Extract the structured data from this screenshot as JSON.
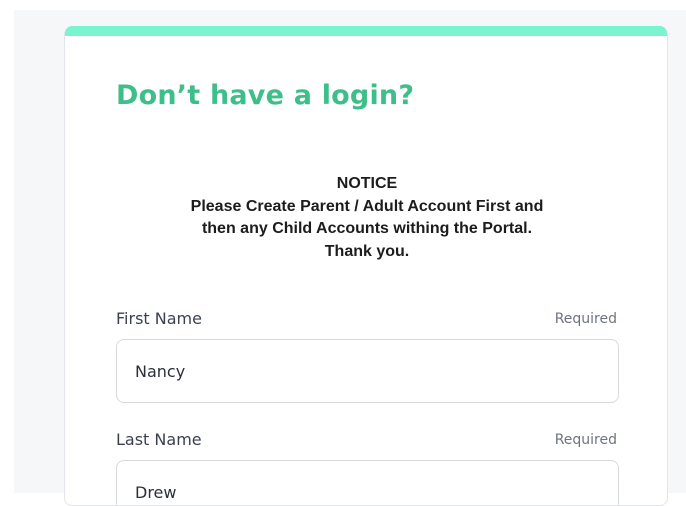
{
  "form": {
    "title": "Don’t have a login?",
    "notice": {
      "heading": "NOTICE",
      "line1": "Please Create Parent / Adult Account First and",
      "line2": "then any Child Accounts withing the Portal.",
      "line3": "Thank you."
    },
    "fields": [
      {
        "label": "First Name",
        "required_label": "Required",
        "value": "Nancy"
      },
      {
        "label": "Last Name",
        "required_label": "Required",
        "value": "Drew"
      }
    ]
  },
  "colors": {
    "accent_bar": "#79f4cf",
    "title": "#3ebf8a"
  }
}
